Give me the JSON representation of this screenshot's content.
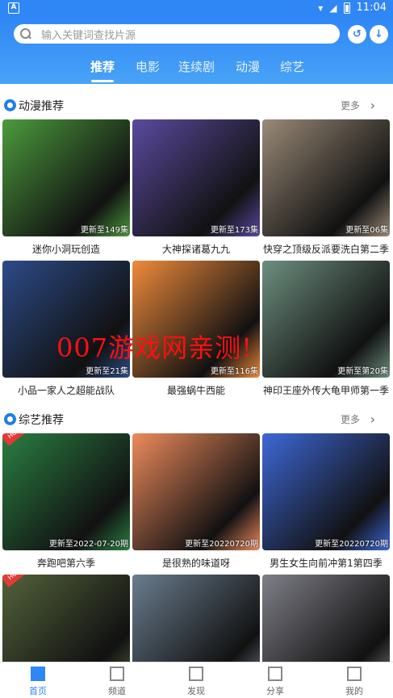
{
  "status_bar": {
    "left_icon": "A",
    "time": "11:04"
  },
  "search": {
    "placeholder": "输入关键词查找片源"
  },
  "tabs": [
    {
      "label": "推荐"
    },
    {
      "label": "电影"
    },
    {
      "label": "连续剧"
    },
    {
      "label": "动漫"
    },
    {
      "label": "综艺"
    }
  ],
  "sections": [
    {
      "title": "动漫推荐",
      "more": "更多"
    },
    {
      "title": "综艺推荐",
      "more": "更多"
    }
  ],
  "anime": [
    {
      "title": "迷你小洞玩创造",
      "badge": "更新至149集",
      "color": "#4c9b3d"
    },
    {
      "title": "大神探诸葛九九",
      "badge": "更新至173集",
      "color": "#5b4a9f"
    },
    {
      "title": "快穿之顶级反派要洗白第二季",
      "badge": "更新至06集",
      "color": "#9b8a78"
    },
    {
      "title": "小品一家人之超能战队",
      "badge": "更新至21集",
      "color": "#2c4b88"
    },
    {
      "title": "最强蜗牛西能",
      "badge": "更新至116集",
      "color": "#f08b3b"
    },
    {
      "title": "神印王座外传大龟甲师第一季",
      "badge": "更新至第20集",
      "color": "#6d8f7f"
    }
  ],
  "variety": [
    {
      "title": "奔跑吧第六季",
      "badge": "更新至2022-07-20期",
      "color": "#2a7f42",
      "hot": "HOT"
    },
    {
      "title": "是很熟的味道呀",
      "badge": "更新至20220720期",
      "color": "#ef8b5c"
    },
    {
      "title": "男生女生向前冲第1第四季",
      "badge": "更新至20220720期",
      "color": "#3e68d8"
    },
    {
      "title": "",
      "badge": "",
      "color": "#53623a",
      "hot": "HOT"
    },
    {
      "title": "",
      "badge": "",
      "color": "#6a7d8f"
    },
    {
      "title": "",
      "badge": "",
      "color": "#7f7f88"
    }
  ],
  "watermark": "007游戏网亲测!",
  "bottom_nav": [
    {
      "label": "首页"
    },
    {
      "label": "频道"
    },
    {
      "label": "发现"
    },
    {
      "label": "分享"
    },
    {
      "label": "我的"
    }
  ]
}
